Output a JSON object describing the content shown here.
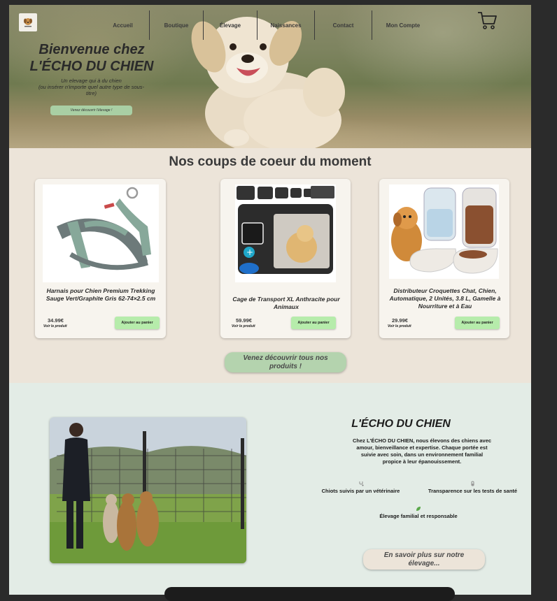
{
  "nav": {
    "items": [
      {
        "label": "Accueil",
        "name": "nav-accueil"
      },
      {
        "label": "Boutique",
        "name": "nav-boutique"
      },
      {
        "label": "Élevage",
        "name": "nav-elevage"
      },
      {
        "label": "Naissances",
        "name": "nav-naissances"
      },
      {
        "label": "Contact",
        "name": "nav-contact"
      },
      {
        "label": "Mon Compte",
        "name": "nav-mon-compte"
      }
    ]
  },
  "hero": {
    "title_line1": "Bienvenue chez",
    "title_line2": "L'ÉCHO DU CHIEN",
    "subtitle_line1": "Un elevage qui à du chien",
    "subtitle_line2": "(ou insérer n'importe quel autre type de sous-titre)",
    "button": "Venez découvrir l'élevage !"
  },
  "products": {
    "section_title": "Nos coups de coeur du moment",
    "items": [
      {
        "name": "Harnais pour Chien Premium Trekking Sauge Vert/Graphite Gris 62-74×2.5 cm",
        "price": "34.99€",
        "link": "Voir le produit",
        "button": "Ajouter au panier"
      },
      {
        "name": "Cage de Transport XL Anthracite pour Animaux",
        "price": "59.99€",
        "link": "Voir le produit",
        "button": "Ajouter au panier"
      },
      {
        "name": "Distributeur Croquettes Chat, Chien, Automatique, 2 Unités, 3.8 L, Gamelle à Nourriture et à Eau",
        "price": "29.99€",
        "link": "Voir le produit",
        "button": "Ajouter au panier"
      }
    ],
    "all_button": "Venez découvrir tous nos produits !"
  },
  "about": {
    "title": "L'ÉCHO DU CHIEN",
    "text": "Chez L'ÉCHO DU CHIEN, nous élevons des chiens avec amour, bienveillance et expertise. Chaque portée est suivie avec soin, dans un environnement familial propice à leur épanouissement.",
    "features": [
      {
        "label": "Chiots suivis par un vétérinaire",
        "icon": "stethoscope-icon"
      },
      {
        "label": "Transparence sur les tests de santé",
        "icon": "test-icon"
      },
      {
        "label": "Élevage familial et responsable",
        "icon": "leaf-icon"
      }
    ],
    "button": "En savoir plus sur notre élevage..."
  },
  "colors": {
    "page_bg": "#ece4d9",
    "about_bg": "#e3ece6",
    "green_button": "#b6ecab",
    "frame": "#2b2b2b"
  }
}
